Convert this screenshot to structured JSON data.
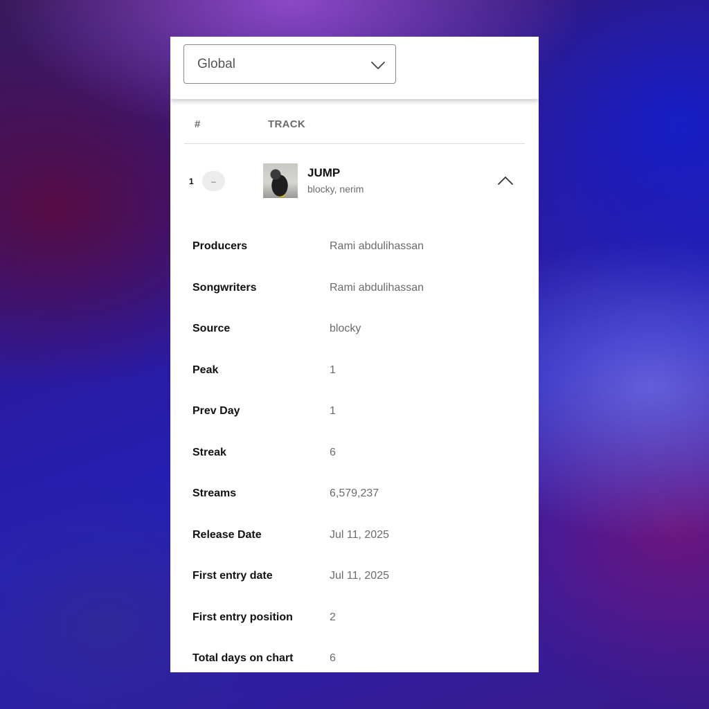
{
  "region_select": {
    "value": "Global"
  },
  "table": {
    "headers": {
      "rank": "#",
      "track": "TRACK"
    },
    "rows": [
      {
        "rank": "1",
        "change": "–",
        "title": "JUMP",
        "artists": "blocky, nerim",
        "expanded": true
      }
    ]
  },
  "details": [
    {
      "label": "Producers",
      "value": "Rami abdulihassan"
    },
    {
      "label": "Songwriters",
      "value": "Rami abdulihassan"
    },
    {
      "label": "Source",
      "value": "blocky"
    },
    {
      "label": "Peak",
      "value": "1"
    },
    {
      "label": "Prev Day",
      "value": "1"
    },
    {
      "label": "Streak",
      "value": "6"
    },
    {
      "label": "Streams",
      "value": "6,579,237"
    },
    {
      "label": "Release Date",
      "value": "Jul 11, 2025"
    },
    {
      "label": "First entry date",
      "value": "Jul 11, 2025"
    },
    {
      "label": "First entry position",
      "value": "2"
    },
    {
      "label": "Total days on chart",
      "value": "6"
    }
  ],
  "icons": {
    "dropdown": "chevron-down-icon",
    "collapse": "chevron-up-icon"
  },
  "colors": {
    "card_background": "#ffffff",
    "label_text": "#111111",
    "value_text": "#6b6b6b"
  }
}
